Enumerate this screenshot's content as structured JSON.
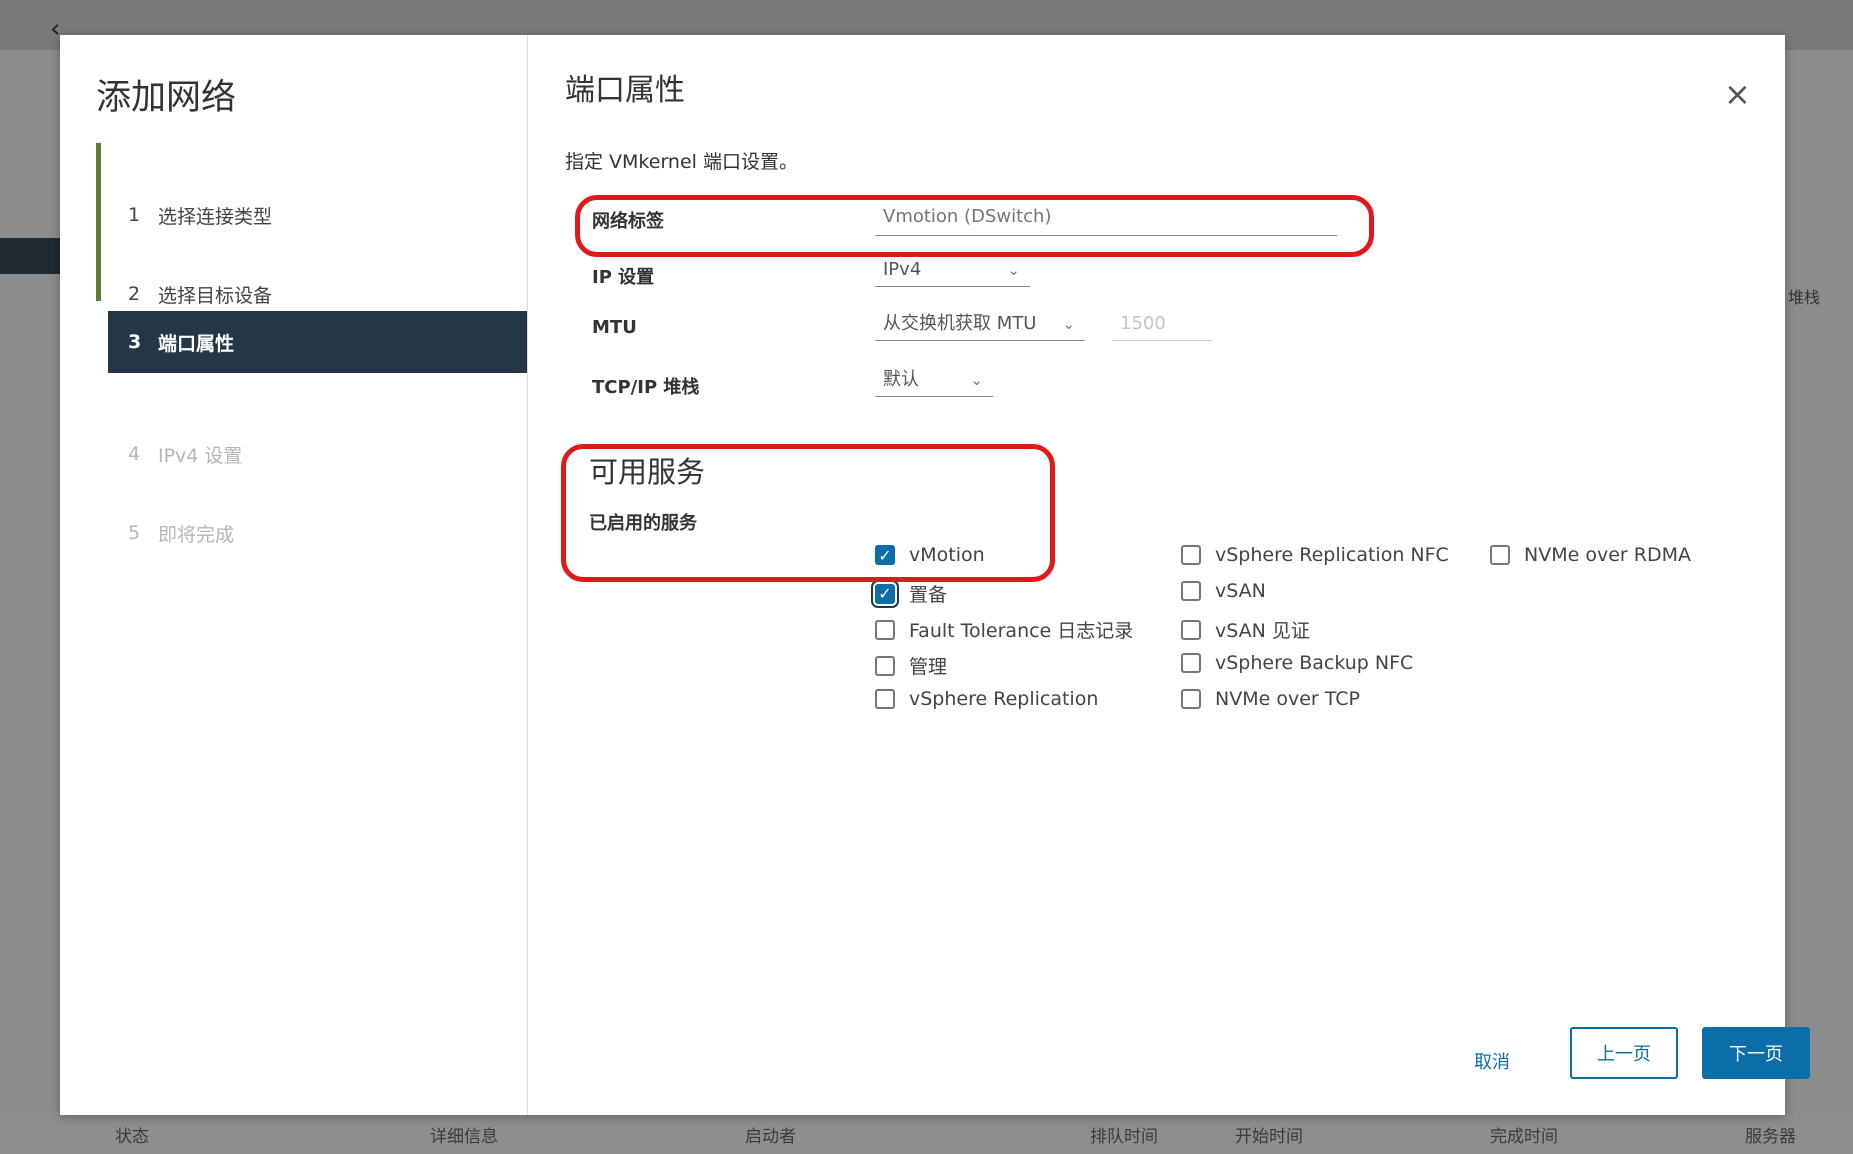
{
  "background": {
    "back_glyph": "‹",
    "right_text": "堆栈",
    "footer_columns": [
      "状态",
      "详细信息",
      "启动者",
      "排队时间",
      "开始时间",
      "完成时间",
      "服务器"
    ]
  },
  "wizard": {
    "title": "添加网络",
    "steps": [
      {
        "num": "1",
        "label": "选择连接类型"
      },
      {
        "num": "2",
        "label": "选择目标设备"
      },
      {
        "num": "3",
        "label": "端口属性"
      },
      {
        "num": "4",
        "label": "IPv4 设置"
      },
      {
        "num": "5",
        "label": "即将完成"
      }
    ]
  },
  "content": {
    "page_title": "端口属性",
    "description": "指定 VMkernel 端口设置。",
    "network_label": {
      "label": "网络标签",
      "value": "Vmotion (DSwitch)"
    },
    "ip_settings": {
      "label": "IP 设置",
      "value": "IPv4"
    },
    "mtu": {
      "label": "MTU",
      "value": "从交换机获取 MTU",
      "number": "1500"
    },
    "tcpip_stack": {
      "label": "TCP/IP 堆栈",
      "value": "默认"
    },
    "services_title": "可用服务",
    "enabled_services_label": "已启用的服务",
    "services": [
      {
        "label": "vMotion",
        "checked": true
      },
      {
        "label": "置备",
        "checked": true
      },
      {
        "label": "Fault Tolerance 日志记录",
        "checked": false
      },
      {
        "label": "管理",
        "checked": false
      },
      {
        "label": "vSphere Replication",
        "checked": false
      },
      {
        "label": "vSphere Replication NFC",
        "checked": false
      },
      {
        "label": "vSAN",
        "checked": false
      },
      {
        "label": "vSAN 见证",
        "checked": false
      },
      {
        "label": "vSphere Backup NFC",
        "checked": false
      },
      {
        "label": "NVMe over TCP",
        "checked": false
      },
      {
        "label": "NVMe over RDMA",
        "checked": false
      }
    ]
  },
  "footer": {
    "cancel": "取消",
    "back": "上一页",
    "next": "下一页"
  },
  "icons": {
    "close": "×",
    "chevron": "⌄",
    "check": "✓"
  },
  "colors": {
    "accent": "#0b6ea8",
    "active_step": "#253746",
    "annotation": "#e01a1a",
    "step_line": "#5c7d2f"
  }
}
